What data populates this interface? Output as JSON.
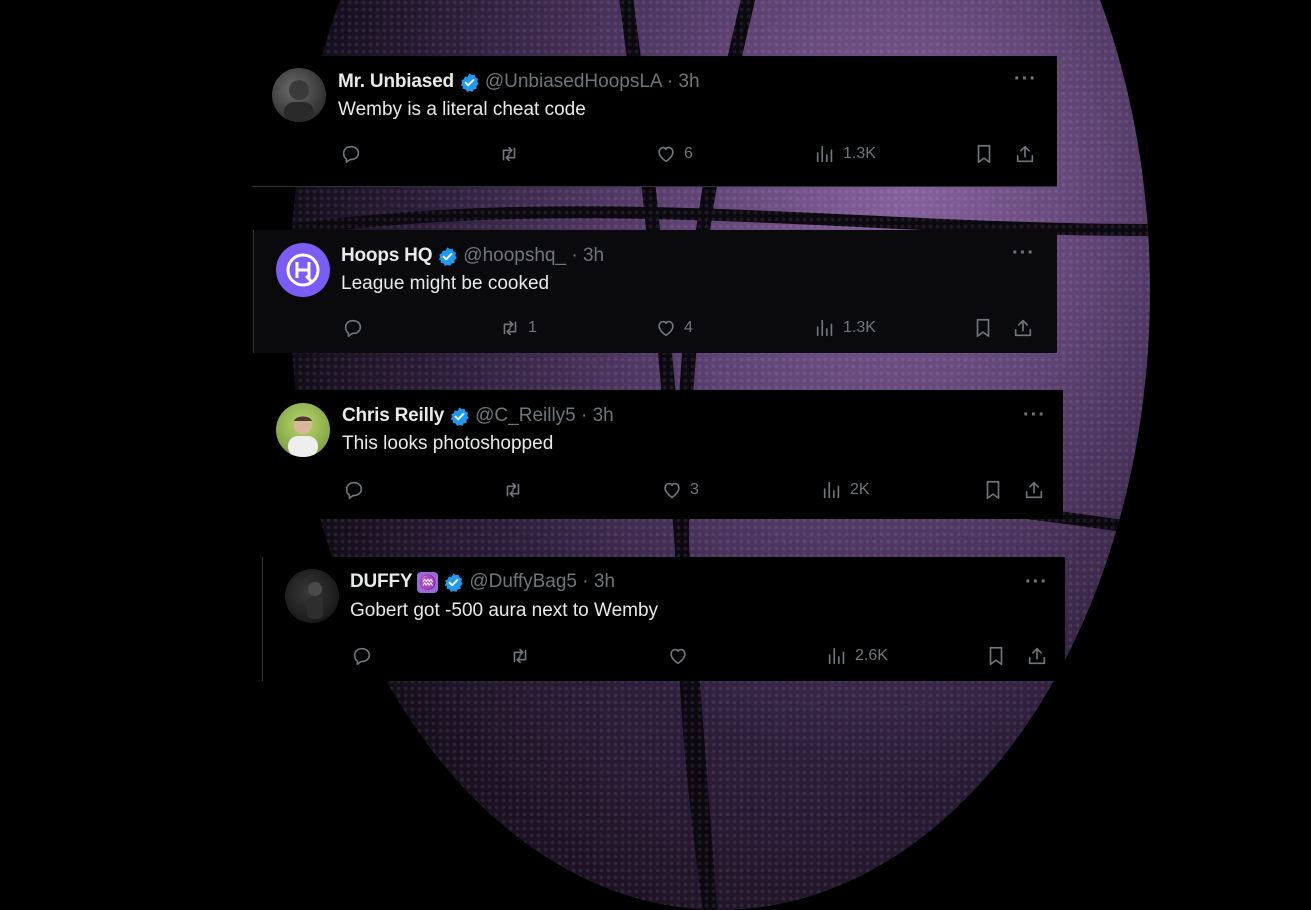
{
  "colors": {
    "verified": "#1d9bf0",
    "secondary_text": "#71767b",
    "primary_text": "#e7e9ea",
    "hoops_avatar": "#7b5cf5",
    "zodiac_badge": "#9a6ad6"
  },
  "tweets": [
    {
      "name": "Mr. Unbiased",
      "handle": "@UnbiasedHoopsLA · 3h",
      "text": "Wemby is a literal cheat code",
      "replies": "",
      "retweets": "",
      "likes": "6",
      "views": "1.3K",
      "more": "···"
    },
    {
      "name": "Hoops HQ",
      "handle": "@hoopshq_ · 3h",
      "text": "League might be cooked",
      "replies": "",
      "retweets": "1",
      "likes": "4",
      "views": "1.3K",
      "more": "···"
    },
    {
      "name": "Chris Reilly",
      "handle": "@C_Reilly5 · 3h",
      "text": "This looks photoshopped",
      "replies": "",
      "retweets": "",
      "likes": "3",
      "views": "2K",
      "more": "···"
    },
    {
      "name": "DUFFY",
      "zodiac": "♒",
      "handle": "@DuffyBag5 · 3h",
      "text": "Gobert got -500 aura next to Wemby",
      "replies": "",
      "retweets": "",
      "likes": "",
      "views": "2.6K",
      "more": "···"
    }
  ],
  "icons": {
    "reply": "reply-icon",
    "retweet": "retweet-icon",
    "like": "heart-icon",
    "views": "views-chart-icon",
    "bookmark": "bookmark-icon",
    "share": "share-icon",
    "verified": "verified-badge-icon"
  }
}
